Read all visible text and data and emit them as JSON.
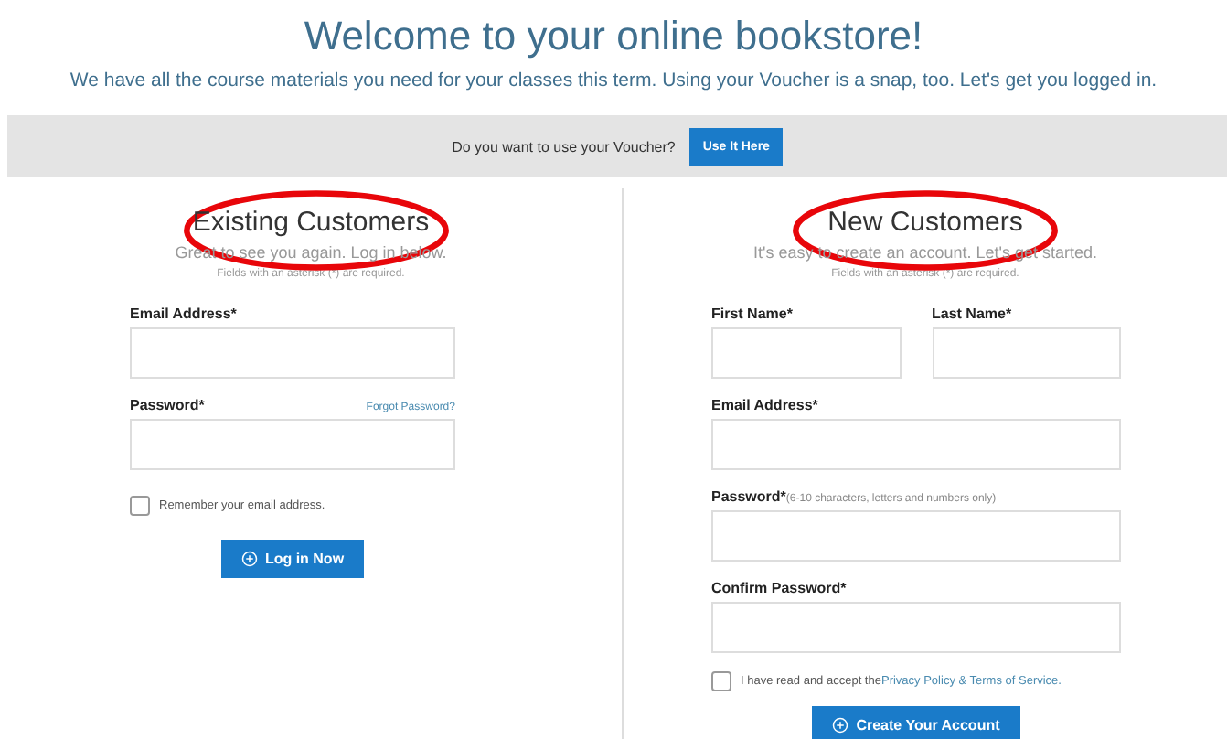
{
  "header": {
    "title": "Welcome to your online bookstore!",
    "subtitle": "We have all the course materials you need for your classes this term. Using your Voucher is a snap, too. Let's get you logged in."
  },
  "voucher_bar": {
    "question": "Do you want to use your Voucher?",
    "button": "Use It Here"
  },
  "panels": [
    {
      "heading": "Existing Customers",
      "circled": true,
      "intro": "Great to see you again. Log in below.",
      "note": "Fields with an asterisk (*) are required.",
      "field_rows": [
        [
          {
            "label": "Email Address*"
          }
        ],
        [
          {
            "label": "Password*",
            "link": "Forgot Password?"
          }
        ]
      ],
      "checkbox": {
        "label": "Remember your email address.",
        "checked": false
      },
      "button": "Log in Now"
    },
    {
      "heading": "New Customers",
      "circled": true,
      "intro": "It's easy to create an account. Let's get started.",
      "note": "Fields with an asterisk (*) are required.",
      "field_rows": [
        [
          {
            "label": "First Name*"
          },
          {
            "label": "Last Name*"
          }
        ],
        [
          {
            "label": "Email Address*"
          }
        ],
        [
          {
            "label": "Password*",
            "hint": "(6-10 characters, letters and numbers only)"
          }
        ],
        [
          {
            "label": "Confirm Password*"
          }
        ]
      ],
      "checkbox": {
        "label": "I have read and accept the",
        "link": "Privacy Policy & Terms of Service.",
        "checked": false
      },
      "button": "Create Your Account"
    }
  ]
}
